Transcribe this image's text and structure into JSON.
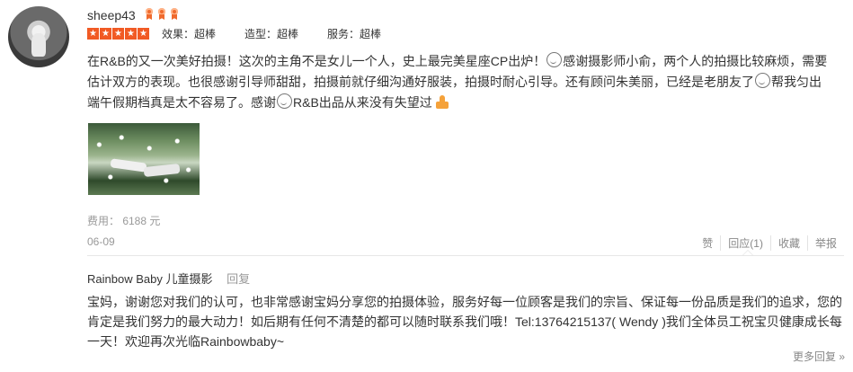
{
  "review": {
    "username": "sheep43",
    "medal_count": 3,
    "stars": 5,
    "ratings": [
      {
        "label": "效果：超棒"
      },
      {
        "label": "造型：超棒"
      },
      {
        "label": "服务：超棒"
      }
    ],
    "text_part1": "在R&B的又一次美好拍摄！这次的主角不是女儿一个人，史上最完美星座CP出炉！",
    "text_part2": "感谢摄影师小俞，两个人的拍摄比较麻烦，需要估计双方的表现。也很感谢引导师甜甜，拍摄前就仔细沟通好服装，拍摄时耐心引导。还有顾问朱美丽，已经是老朋友了",
    "text_part3": "帮我匀出端午假期档真是太不容易了。感谢",
    "text_part4": "R&B出品从来没有失望过",
    "fee": "费用： 6188 元",
    "date": "06-09",
    "actions": {
      "like": "赞",
      "reply": "回应(1)",
      "favorite": "收藏",
      "report": "举报"
    }
  },
  "reply": {
    "author": "Rainbow Baby 儿童摄影",
    "reply_link": "回复",
    "text": "宝妈，谢谢您对我们的认可，也非常感谢宝妈分享您的拍摄体验，服务好每一位顾客是我们的宗旨、保证每一份品质是我们的追求，您的肯定是我们努力的最大动力！如后期有任何不清楚的都可以随时联系我们哦！Tel:13764215137( Wendy )我们全体员工祝宝贝健康成长每一天！欢迎再次光临Rainbowbaby~"
  },
  "more_replies": "更多回复 »",
  "colors": {
    "star_orange": "#f15a24",
    "medal_orange": "#f06a2d",
    "muted_gray": "#999999"
  }
}
